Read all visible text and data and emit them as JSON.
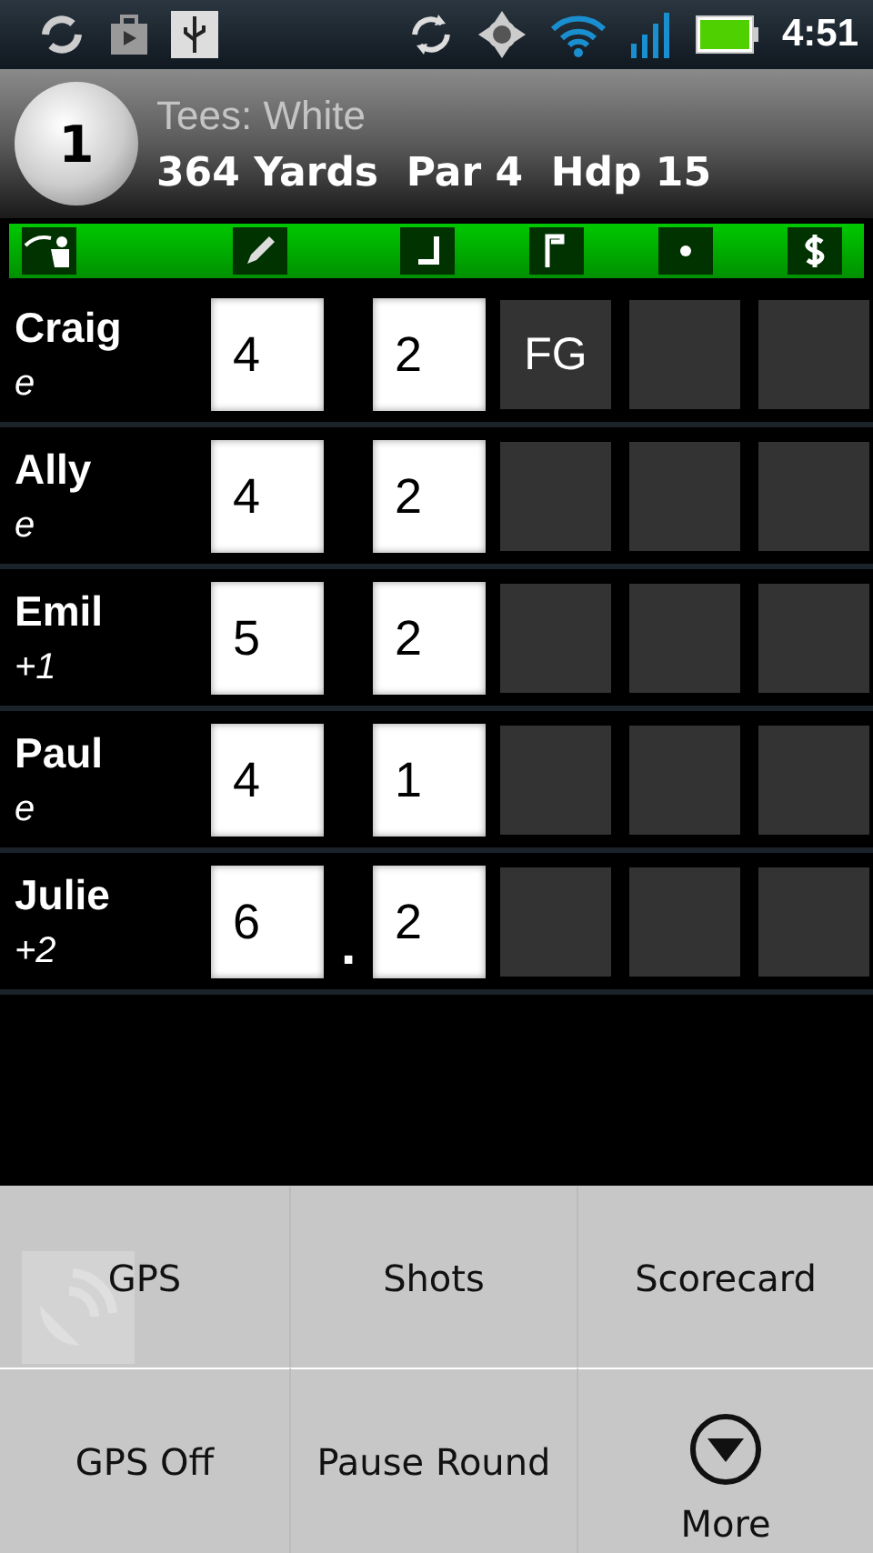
{
  "status_bar": {
    "time": "4:51"
  },
  "hole": {
    "number": "1",
    "tees": "Tees: White",
    "info": "364 Yards  Par 4  Hdp 15"
  },
  "players": [
    {
      "name": "Craig",
      "score_to_par": "e",
      "strokes": "4",
      "putts": "2",
      "fairway": "FG"
    },
    {
      "name": "Ally",
      "score_to_par": "e",
      "strokes": "4",
      "putts": "2"
    },
    {
      "name": "Emil",
      "score_to_par": "+1",
      "strokes": "5",
      "putts": "2"
    },
    {
      "name": "Paul",
      "score_to_par": "e",
      "strokes": "4",
      "putts": "1"
    },
    {
      "name": "Julie",
      "score_to_par": "+2",
      "strokes": "6",
      "putts": "2",
      "separator": "."
    }
  ],
  "menu": [
    {
      "kind": "text",
      "label": "GPS"
    },
    {
      "kind": "text",
      "label": "Shots"
    },
    {
      "kind": "text",
      "label": "Scorecard"
    },
    {
      "kind": "text",
      "label": "GPS Off"
    },
    {
      "kind": "text",
      "label": "Pause Round"
    },
    {
      "kind": "more",
      "label": "More"
    }
  ]
}
